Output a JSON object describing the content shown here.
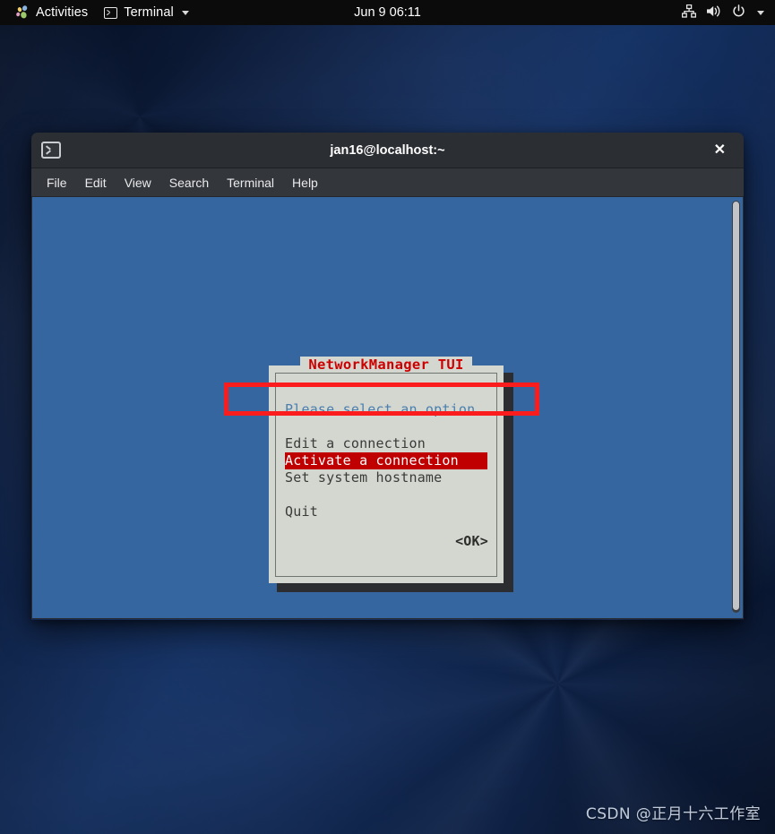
{
  "topbar": {
    "activities_label": "Activities",
    "activities_icon": "gnome-logo-icon",
    "app_label": "Terminal",
    "app_icon": "terminal-icon",
    "app_caret_icon": "chevron-down-icon",
    "clock": "Jun 9  06:11",
    "status_icons": [
      {
        "name": "network-wired-icon"
      },
      {
        "name": "volume-icon"
      },
      {
        "name": "power-icon"
      },
      {
        "name": "chevron-down-icon"
      }
    ]
  },
  "terminal": {
    "title": "jan16@localhost:~",
    "window_icon": "terminal-icon",
    "close_label": "✕",
    "menu": [
      {
        "label": "File"
      },
      {
        "label": "Edit"
      },
      {
        "label": "View"
      },
      {
        "label": "Search"
      },
      {
        "label": "Terminal"
      },
      {
        "label": "Help"
      }
    ],
    "background_color": "#36669f",
    "scrollbar": "vertical-scrollbar"
  },
  "tui_dialog": {
    "title": "NetworkManager TUI",
    "title_color": "#cc0000",
    "prompt": "Please select an option",
    "prompt_color": "#4a7fae",
    "background_color": "#d4d6d0",
    "options": [
      {
        "label": "Edit a connection",
        "selected": false
      },
      {
        "label": "Activate a connection",
        "selected": true
      },
      {
        "label": "Set system hostname",
        "selected": false
      },
      {
        "label": "Quit",
        "selected": false
      }
    ],
    "selected_bg_color": "#c00000",
    "ok_button": "<OK>"
  },
  "annotation": {
    "color": "#fb1d1d",
    "target": "Activate a connection"
  },
  "watermark": {
    "text": "CSDN @正月十六工作室"
  }
}
